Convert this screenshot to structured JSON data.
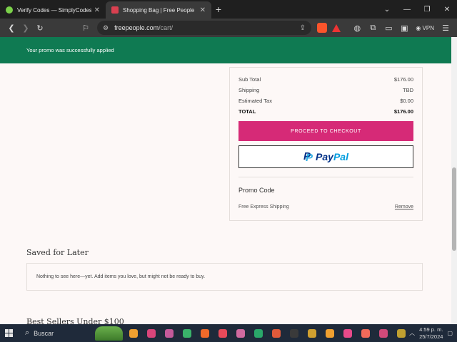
{
  "browser": {
    "tabs": [
      {
        "title": "Verify Codes — SimplyCodes",
        "active": false,
        "favicon_color": "#7bd14a"
      },
      {
        "title": "Shopping Bag | Free People",
        "active": true,
        "favicon_color": "#d94050"
      }
    ],
    "new_tab_label": "+",
    "url_domain": "freepeople.com",
    "url_path": "/cart/",
    "vpn_label": "VPN"
  },
  "promo_banner": {
    "message": "Your promo was successfully applied"
  },
  "order_summary": {
    "subtotal_label": "Sub Total",
    "subtotal_value": "$176.00",
    "shipping_label": "Shipping",
    "shipping_value": "TBD",
    "tax_label": "Estimated Tax",
    "tax_value": "$0.00",
    "total_label": "TOTAL",
    "total_value": "$176.00",
    "checkout_label": "PROCEED TO CHECKOUT",
    "paypal_pay": "Pay",
    "paypal_pal": "Pal",
    "promo_code_label": "Promo Code",
    "applied_promo": "Free Express Shipping",
    "remove_label": "Remove"
  },
  "saved_for_later": {
    "title": "Saved for Later",
    "empty_message": "Nothing to see here—yet. Add items you love, but might not be ready to buy."
  },
  "best_sellers_title": "Best Sellers Under $100",
  "taskbar": {
    "search_label": "Buscar",
    "time": "4:59 p. m.",
    "date": "25/7/2024",
    "app_colors": [
      "#f0a030",
      "#d9457a",
      "#c45a9a",
      "#3ab36a",
      "#f06a2a",
      "#e84a5a",
      "#d06aa0",
      "#2aa86a",
      "#e05a3a",
      "#3a3a3a",
      "#d0a030",
      "#f0a030",
      "#e84a8a",
      "#f06a5a",
      "#d04a7a",
      "#c0a030"
    ]
  }
}
